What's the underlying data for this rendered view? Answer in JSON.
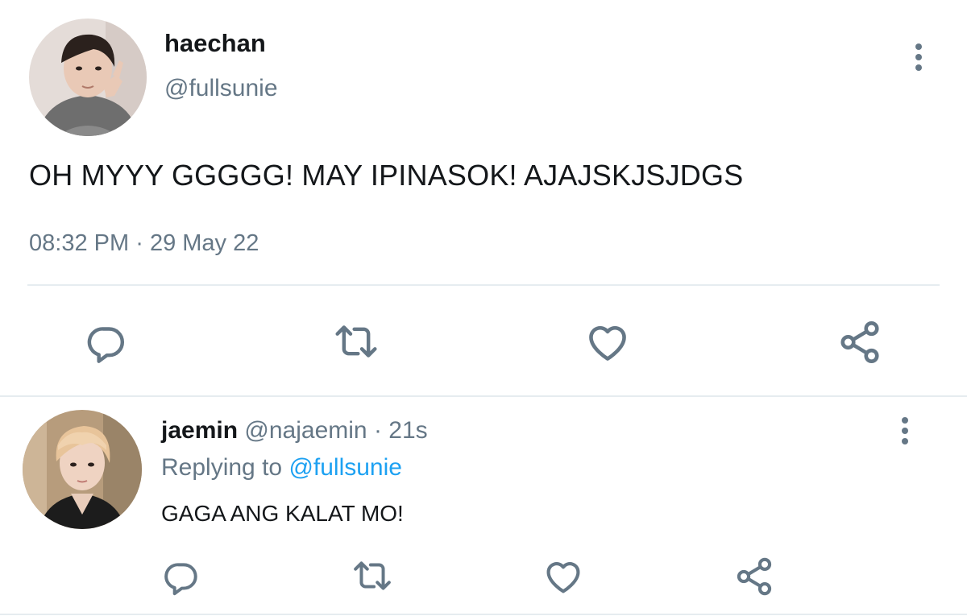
{
  "main_tweet": {
    "display_name": "haechan",
    "handle": "@fullsunie",
    "text": "OH MYYY GGGGG! MAY IPINASOK! AJAJSKJSJDGS",
    "time": "08:32 PM",
    "separator": "·",
    "date": "29 May 22",
    "actions": [
      "reply-icon",
      "retweet-icon",
      "like-icon",
      "share-icon"
    ]
  },
  "reply": {
    "display_name": "jaemin",
    "handle": "@najaemin",
    "separator": "·",
    "age": "21s",
    "replying_prefix": "Replying to",
    "replying_to": "@fullsunie",
    "text": "GAGA ANG KALAT MO!",
    "actions": [
      "reply-icon",
      "retweet-icon",
      "like-icon",
      "share-icon"
    ]
  },
  "colors": {
    "text": "#14171a",
    "muted": "#657786",
    "link": "#1da1f2",
    "divider": "#e6ecf0"
  }
}
